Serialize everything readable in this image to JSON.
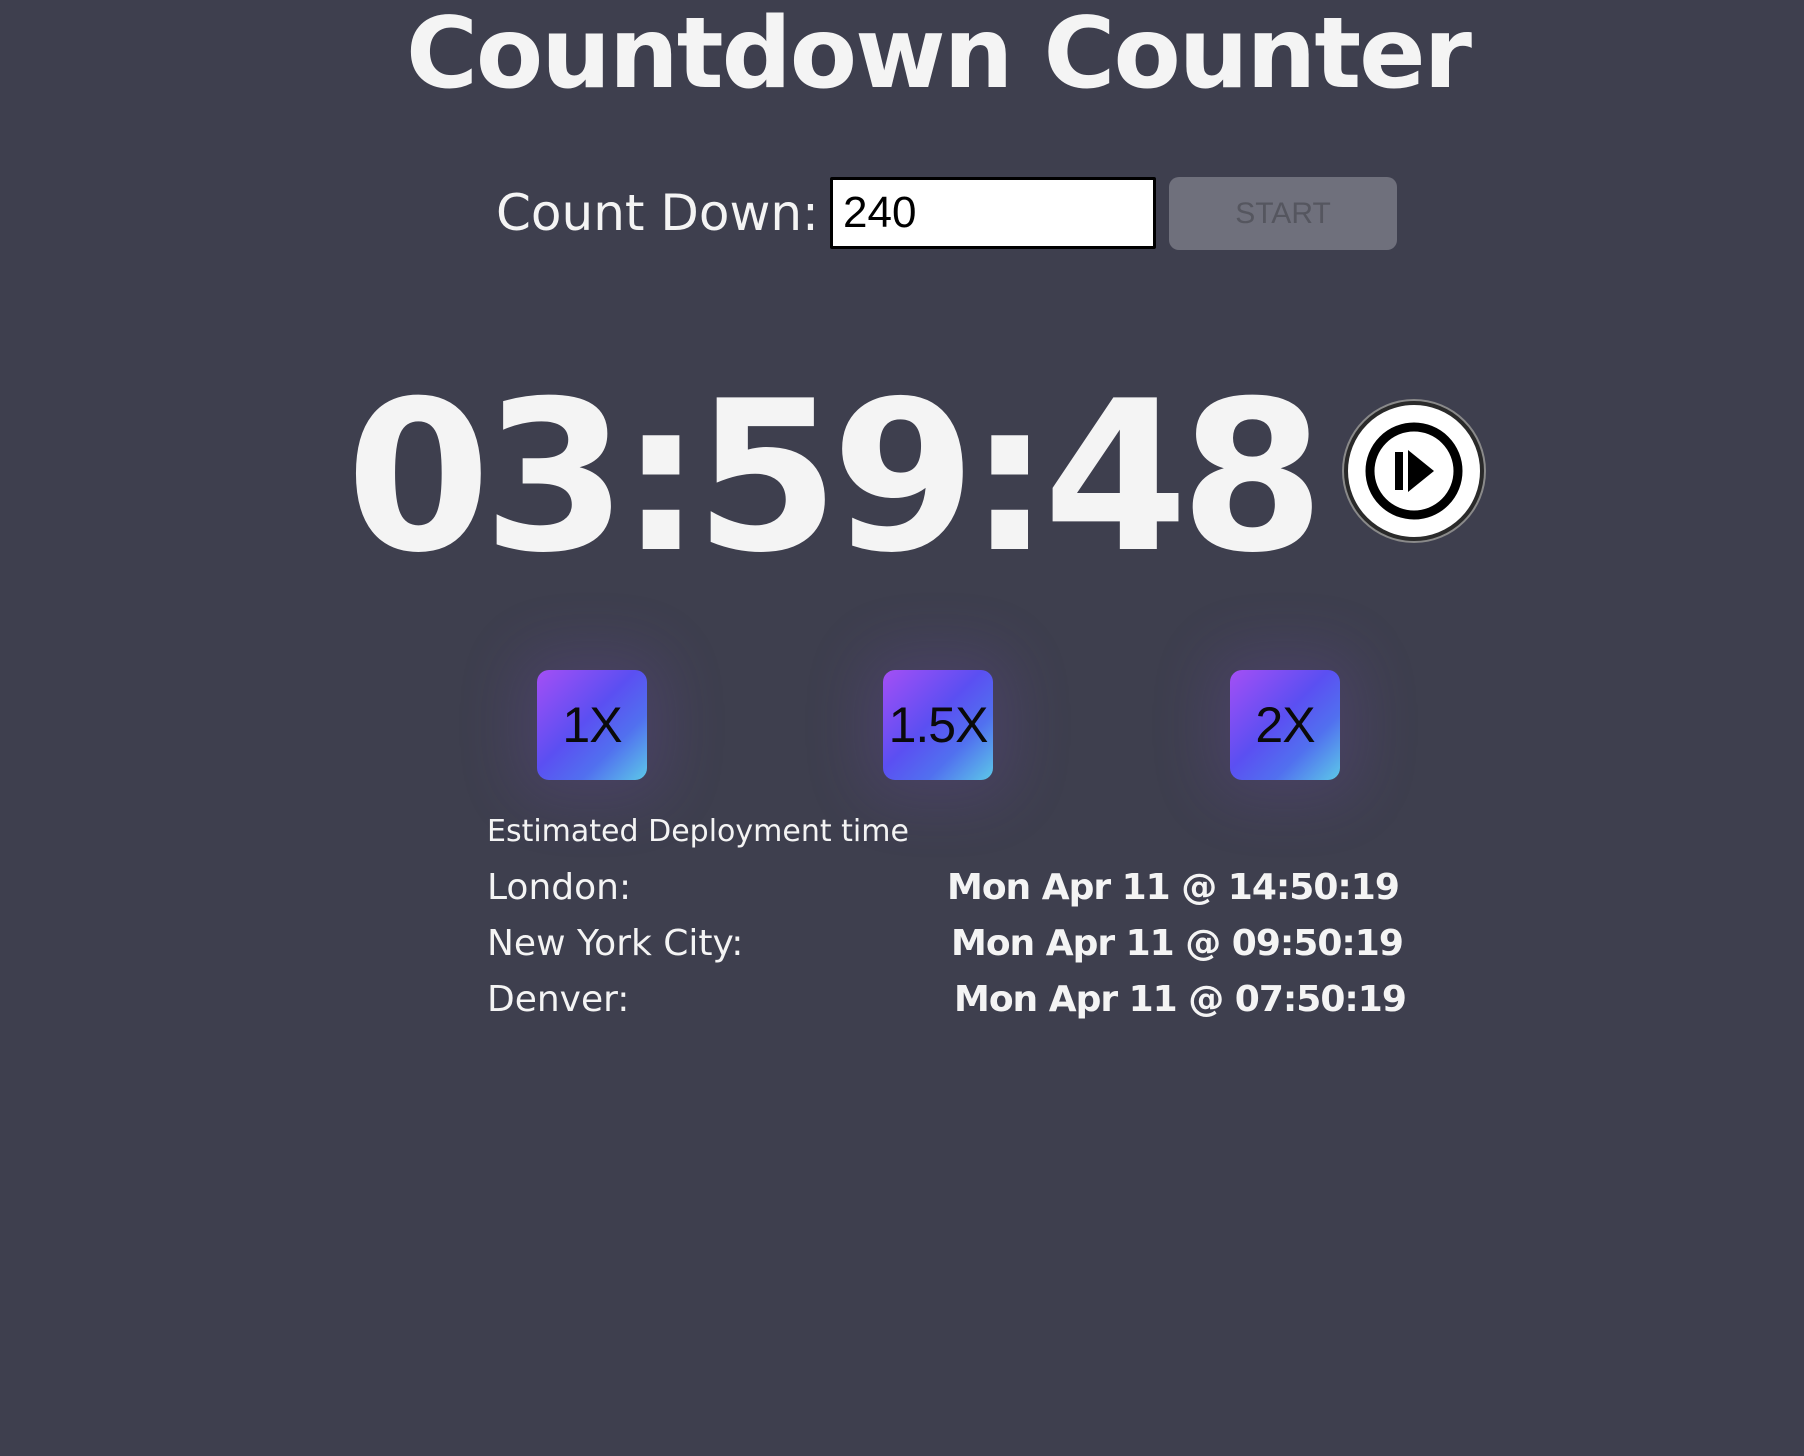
{
  "app": {
    "title": "Countdown Counter"
  },
  "form": {
    "label": "Count Down:",
    "input_value": "240",
    "start_label": "START"
  },
  "timer": {
    "display": "03:59:48",
    "play_icon": "play-circle-icon"
  },
  "speeds": [
    {
      "label": "1X"
    },
    {
      "label": "1.5X"
    },
    {
      "label": "2X"
    }
  ],
  "deployment": {
    "heading": "Estimated Deployment time",
    "rows": [
      {
        "city": "London:",
        "time": "Mon Apr 11 @ 14:50:19"
      },
      {
        "city": "New York City:",
        "time": "Mon Apr 11 @ 09:50:19"
      },
      {
        "city": "Denver:",
        "time": "Mon Apr 11 @ 07:50:19"
      }
    ]
  },
  "colors": {
    "background": "#3e3f4e",
    "text": "#f4f4f4",
    "start_button": "#6f707c",
    "speed_gradient_start": "#a44ff5",
    "speed_gradient_end": "#5cc8e8"
  }
}
